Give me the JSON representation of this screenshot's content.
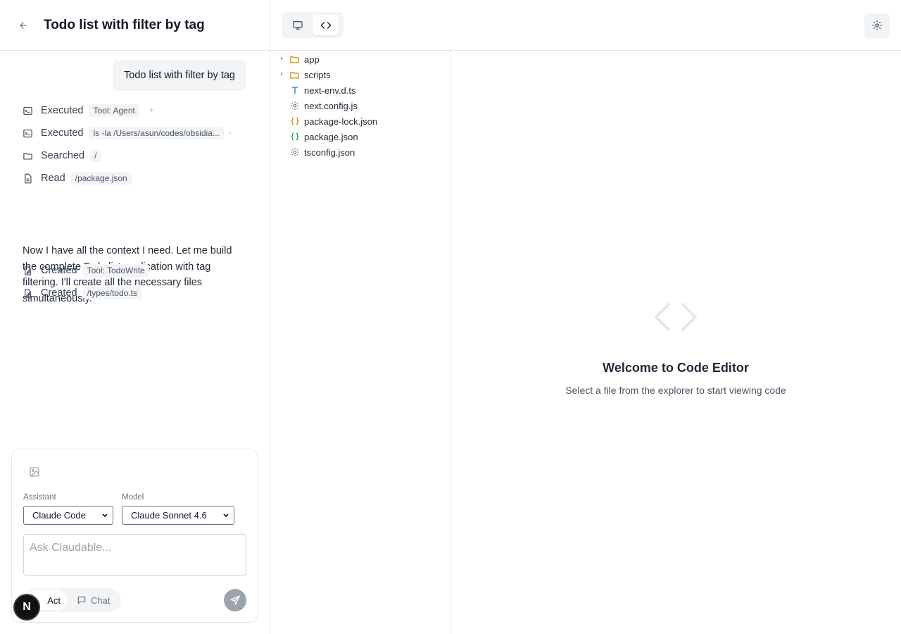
{
  "left": {
    "title": "Todo list with filter by tag",
    "user_message": "Todo list with filter by tag",
    "tool_rows": [
      {
        "verb": "Executed",
        "tag": "Tool: Agent",
        "icon": "terminal-icon"
      },
      {
        "verb": "Executed",
        "tag": "ls -la /Users/asun/codes/obsidia...",
        "icon": "terminal-icon"
      },
      {
        "verb": "Searched",
        "tag": "/",
        "icon": "folder-icon"
      },
      {
        "verb": "Read",
        "tag": "/package.json",
        "icon": "file-icon"
      }
    ],
    "paragraph": "Now I have all the context I need. Let me build the complete Todo list application with tag filtering. I'll create all the necessary files simultaneously.",
    "created_rows": [
      {
        "verb": "Created",
        "tag": "Tool: TodoWrite",
        "icon": "file-edit-icon"
      },
      {
        "verb": "Created",
        "tag": "/types/todo.ts",
        "icon": "file-edit-icon"
      }
    ]
  },
  "composer": {
    "assistant_label": "Assistant",
    "assistant_value": "Claude Code",
    "model_label": "Model",
    "model_value": "Claude Sonnet 4.6",
    "placeholder": "Ask Claudable...",
    "act_label": "Act",
    "chat_label": "Chat",
    "badge_letter": "N"
  },
  "explorer": {
    "items": [
      {
        "name": "app",
        "type": "folder",
        "icon": "folder-icon",
        "color": "#ca8a04"
      },
      {
        "name": "scripts",
        "type": "folder",
        "icon": "folder-icon",
        "color": "#ca8a04"
      },
      {
        "name": "next-env.d.ts",
        "type": "file",
        "icon": "typescript-icon",
        "color": "#2563eb"
      },
      {
        "name": "next.config.js",
        "type": "file",
        "icon": "gear-icon",
        "color": "#6b7280"
      },
      {
        "name": "package-lock.json",
        "type": "file",
        "icon": "json-icon",
        "color": "#ca8a04"
      },
      {
        "name": "package.json",
        "type": "file",
        "icon": "json-icon",
        "color": "#16a34a"
      },
      {
        "name": "tsconfig.json",
        "type": "file",
        "icon": "gear-icon",
        "color": "#6b7280"
      }
    ]
  },
  "editor": {
    "welcome_title": "Welcome to Code Editor",
    "welcome_subtitle": "Select a file from the explorer to start viewing code"
  }
}
